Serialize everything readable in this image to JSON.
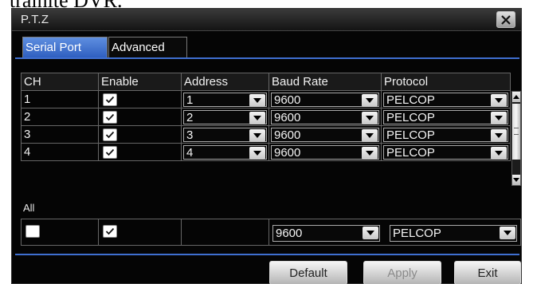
{
  "page_fragment": "traînite DVR.",
  "dialog": {
    "title": "P.T.Z",
    "close_icon": "close-x-icon"
  },
  "tabs": [
    {
      "label": "Serial Port",
      "active": true
    },
    {
      "label": "Advanced",
      "active": false
    }
  ],
  "table": {
    "columns": [
      "CH",
      "Enable",
      "Address",
      "Baud Rate",
      "Protocol"
    ],
    "rows": [
      {
        "ch": "1",
        "enabled": true,
        "address": "1",
        "baud_rate": "9600",
        "protocol": "PELCOP"
      },
      {
        "ch": "2",
        "enabled": true,
        "address": "2",
        "baud_rate": "9600",
        "protocol": "PELCOP"
      },
      {
        "ch": "3",
        "enabled": true,
        "address": "3",
        "baud_rate": "9600",
        "protocol": "PELCOP"
      },
      {
        "ch": "4",
        "enabled": true,
        "address": "4",
        "baud_rate": "9600",
        "protocol": "PELCOP"
      }
    ]
  },
  "all": {
    "label": "All",
    "select_all_checked": false,
    "enable_checked": true,
    "baud_rate": "9600",
    "protocol": "PELCOP"
  },
  "buttons": {
    "default": "Default",
    "apply": "Apply",
    "exit": "Exit"
  },
  "colors": {
    "accent": "#3f6fd0",
    "background": "#050505",
    "text": "#f2f2f2"
  }
}
